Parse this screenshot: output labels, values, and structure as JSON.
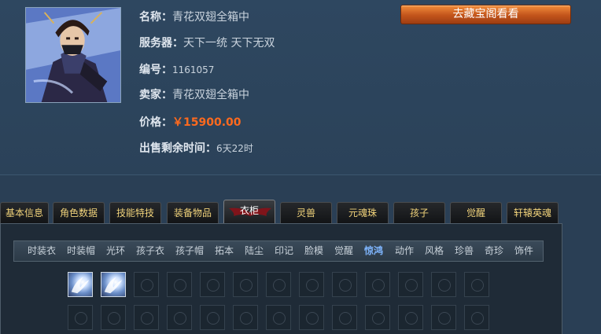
{
  "listing": {
    "name_label": "名称：",
    "name_value": "青花双翅全箱中",
    "server_label": "服务器：",
    "server_value": "天下一统  天下无双",
    "id_label": "编号：",
    "id_value": "1161057",
    "seller_label": "卖家：",
    "seller_value": "青花双翅全箱中",
    "price_label": "价格：",
    "price_value": "￥15900.00",
    "time_label": "出售剩余时间：",
    "time_value": "6天22时",
    "go_button": "去藏宝阁看看"
  },
  "colors": {
    "price": "#ff6a1e",
    "tab_text": "#f0d27a",
    "active_subtab": "#7fb6ff",
    "button": "#c2541b"
  },
  "tabs": [
    {
      "label": "基本信息"
    },
    {
      "label": "角色数据"
    },
    {
      "label": "技能特技"
    },
    {
      "label": "装备物品"
    },
    {
      "label": "衣柜"
    },
    {
      "label": "灵兽"
    },
    {
      "label": "元魂珠"
    },
    {
      "label": "孩子"
    },
    {
      "label": "觉醒"
    },
    {
      "label": "轩辕英魂"
    }
  ],
  "active_tab": "衣柜",
  "subtabs": [
    {
      "label": "时装衣"
    },
    {
      "label": "时装帽"
    },
    {
      "label": "光环"
    },
    {
      "label": "孩子衣"
    },
    {
      "label": "孩子帽"
    },
    {
      "label": "拓本"
    },
    {
      "label": "陆尘"
    },
    {
      "label": "印记"
    },
    {
      "label": "脸模"
    },
    {
      "label": "觉醒"
    },
    {
      "label": "惊鸿"
    },
    {
      "label": "动作"
    },
    {
      "label": "风格"
    },
    {
      "label": "珍兽"
    },
    {
      "label": "奇珍"
    },
    {
      "label": "饰件"
    }
  ],
  "active_subtab": "惊鸿",
  "grid": {
    "filled_slots": 2,
    "slots_per_row": 13,
    "rows_visible": 2
  }
}
